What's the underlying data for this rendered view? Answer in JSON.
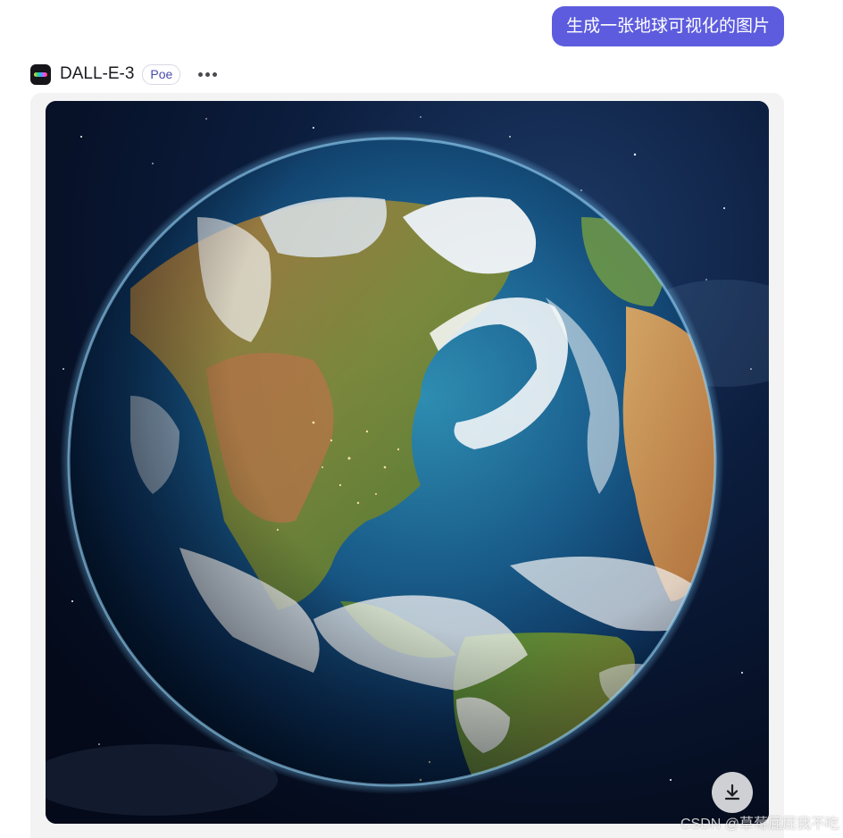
{
  "user_message": {
    "text": "生成一张地球可视化的图片",
    "bubble_color": "#5d5cde"
  },
  "bot": {
    "name": "DALL-E-3",
    "badge": "Poe",
    "avatar_icon": "dalle-avatar-icon",
    "more_icon": "more-dots-icon"
  },
  "generated_image": {
    "subject": "earth-globe-image",
    "download_icon": "download-icon"
  },
  "watermark": {
    "text": "CSDN @草莓屁屁我不吃"
  }
}
